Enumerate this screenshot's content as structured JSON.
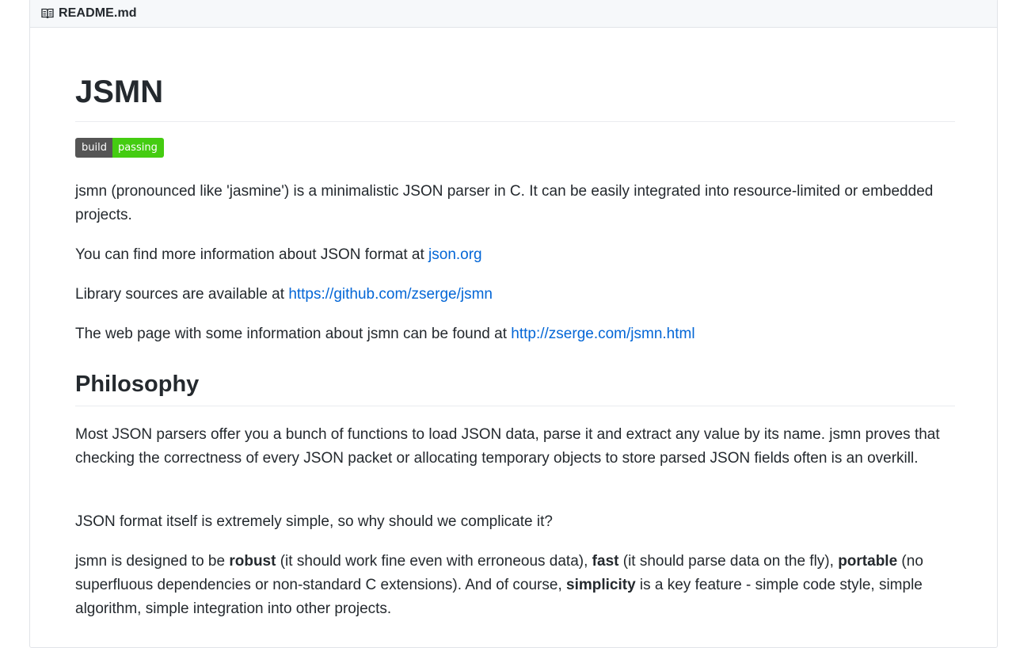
{
  "header": {
    "icon": "book-icon",
    "filename": "README.md"
  },
  "title": "JSMN",
  "badge": {
    "left": "build",
    "right": "passing",
    "left_color": "#555555",
    "right_color": "#44cc11"
  },
  "intro": {
    "p1": "jsmn (pronounced like 'jasmine') is a minimalistic JSON parser in C. It can be easily integrated into resource-limited or embedded projects.",
    "p2_text": "You can find more information about JSON format at ",
    "p2_link": "json.org",
    "p3_text": "Library sources are available at ",
    "p3_link": "https://github.com/zserge/jsmn",
    "p4_text": "The web page with some information about jsmn can be found at ",
    "p4_link": "http://zserge.com/jsmn.html"
  },
  "philosophy": {
    "heading": "Philosophy",
    "p1": "Most JSON parsers offer you a bunch of functions to load JSON data, parse it and extract any value by its name. jsmn proves that checking the correctness of every JSON packet or allocating temporary objects to store parsed JSON fields often is an overkill.",
    "p2": "JSON format itself is extremely simple, so why should we complicate it?",
    "p3": {
      "t1": "jsmn is designed to be ",
      "b1": "robust",
      "t2": " (it should work fine even with erroneous data), ",
      "b2": "fast",
      "t3": " (it should parse data on the fly), ",
      "b3": "portable",
      "t4": " (no superfluous dependencies or non-standard C extensions). And of course, ",
      "b4": "simplicity",
      "t5": " is a key feature - simple code style, simple algorithm, simple integration into other projects."
    }
  },
  "colors": {
    "link": "#0366d6",
    "text": "#24292e",
    "header_bg": "#f6f8fa",
    "border": "#e1e4e8"
  }
}
